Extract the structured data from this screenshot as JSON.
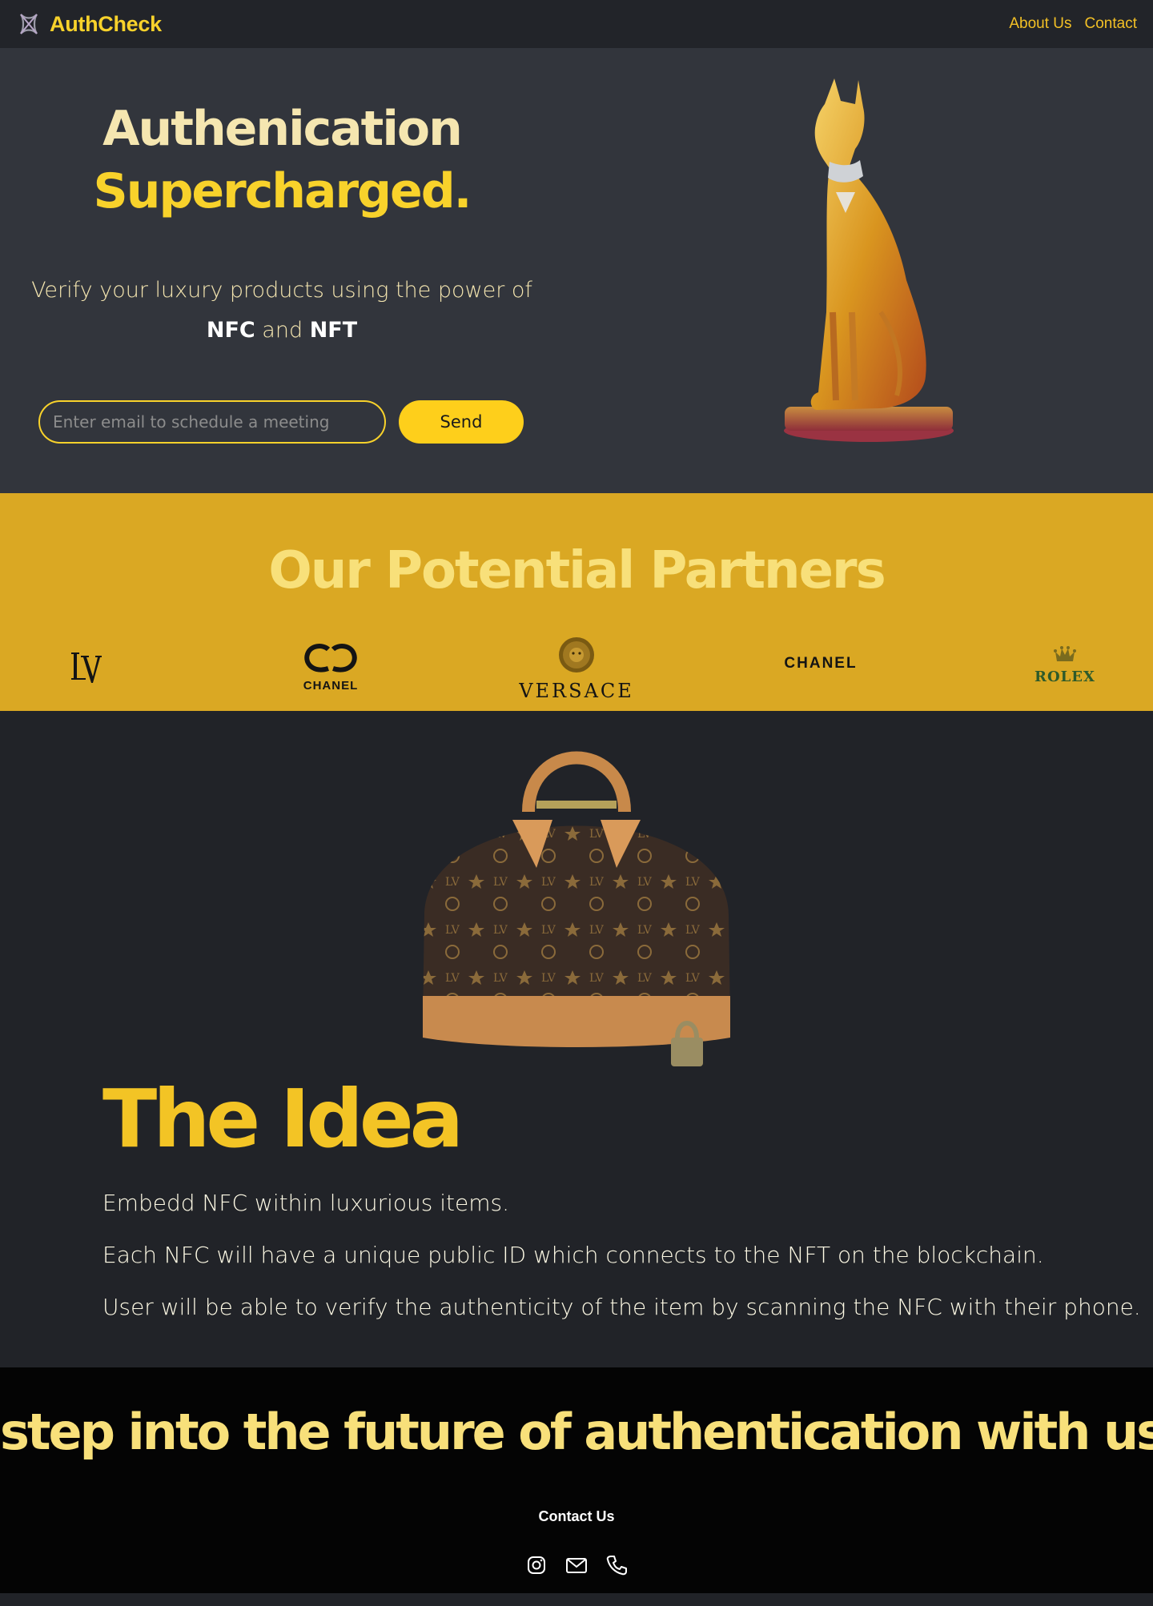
{
  "nav": {
    "brand": "AuthCheck",
    "links": [
      "About Us",
      "Contact"
    ]
  },
  "hero": {
    "title_line1": "Authenication",
    "title_line2": "Supercharged.",
    "subtitle_prefix": "Verify your luxury products using the power of",
    "subtitle_nfc": "NFC",
    "subtitle_and": "and",
    "subtitle_nft": "NFT",
    "email_placeholder": "Enter email to schedule a meeting",
    "send_label": "Send"
  },
  "partners": {
    "title": "Our Potential Partners",
    "logos": [
      "lv-logo",
      "chanel-cc-logo",
      "versace-logo",
      "chanel-wordmark-logo",
      "rolex-logo"
    ],
    "versace_text": "VERSACE",
    "chanel_cc_text": "CHANEL",
    "chanel_word_text": "CHANEL",
    "rolex_text": "ROLEX"
  },
  "idea": {
    "title": "The Idea",
    "lines": [
      "Embedd NFC within luxurious items.",
      "Each NFC will have a unique public ID which connects to the NFT on the blockchain.",
      "User will be able to verify the authenticity of the item by scanning the NFC with their phone."
    ]
  },
  "footer": {
    "tagline": "step into the future of authentication with us",
    "contact_label": "Contact Us",
    "icons": [
      "instagram-icon",
      "mail-icon",
      "phone-icon"
    ]
  },
  "colors": {
    "accent": "#f8d22b",
    "partners_bg": "#daa823",
    "hero_bg": "#32353c",
    "page_bg": "#212328",
    "footer_bg": "#040404"
  }
}
